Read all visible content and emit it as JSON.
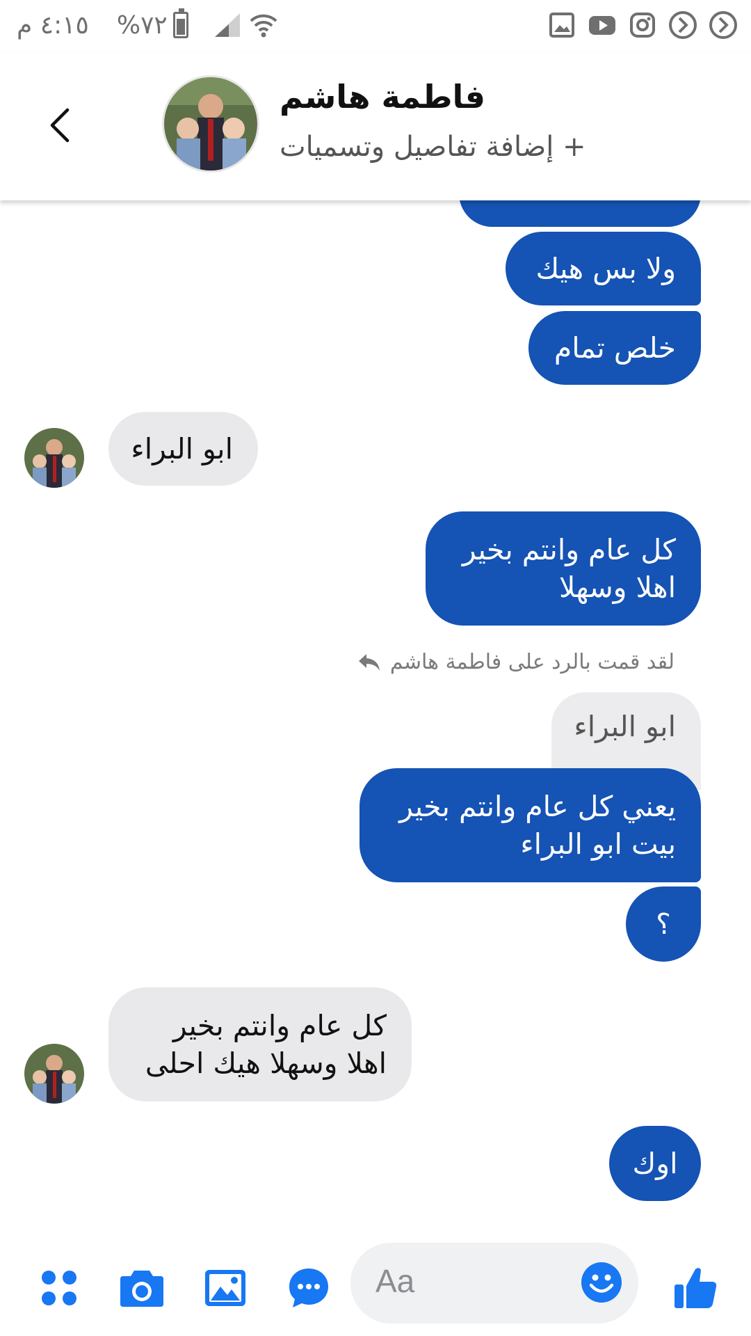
{
  "status_bar": {
    "time": "٤:١٥ م",
    "battery": "%٧٢",
    "battery_level": 0.72,
    "icons": [
      "wifi-icon",
      "signal-icon",
      "battery-icon",
      "gallery-icon",
      "youtube-icon",
      "instagram-icon",
      "app-icon",
      "app-icon"
    ]
  },
  "header": {
    "contact_name": "فاطمة هاشم",
    "subtitle": "+ إضافة تفاصيل وتسميات"
  },
  "messages": [
    {
      "direction": "out",
      "text": "ولا بس هيك"
    },
    {
      "direction": "out",
      "text": "خلص تمام"
    },
    {
      "direction": "in",
      "text": "ابو البراء"
    },
    {
      "direction": "out",
      "lines": [
        "كل عام وانتم بخير",
        "اهلا وسهلا"
      ]
    },
    {
      "direction": "out",
      "lines": [
        "يعني كل عام وانتم بخير",
        "بيت ابو البراء"
      ]
    },
    {
      "direction": "out",
      "text": "؟"
    },
    {
      "direction": "in",
      "lines": [
        "كل عام وانتم بخير",
        "اهلا وسهلا هيك احلى"
      ]
    },
    {
      "direction": "out",
      "text": "اوك"
    }
  ],
  "reply_note": {
    "text": "لقد قمت بالرد على فاطمة هاشم",
    "quoted_text": "ابو البراء"
  },
  "composer": {
    "placeholder": "Aa",
    "icons": [
      "apps-icon",
      "camera-icon",
      "image-icon",
      "chat-bubble-icon",
      "emoji-icon",
      "like-icon"
    ]
  },
  "colors": {
    "outgoing_bubble": "#1553b4",
    "incoming_bubble": "#e9e9eb",
    "accent": "#1877f2"
  }
}
